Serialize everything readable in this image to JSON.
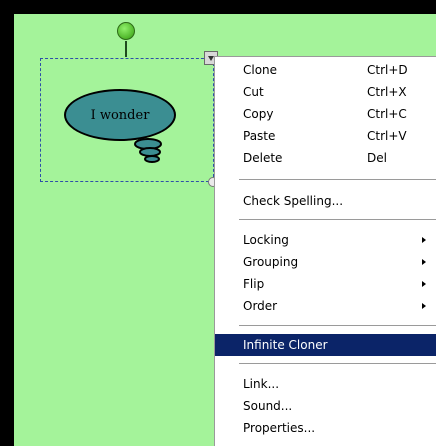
{
  "bubble": {
    "text": "I wonder",
    "fill": "#3b8e92"
  },
  "canvas_color": "#a4f39a",
  "menu": {
    "items": [
      {
        "label": "Clone",
        "shortcut": "Ctrl+D"
      },
      {
        "label": "Cut",
        "shortcut": "Ctrl+X"
      },
      {
        "label": "Copy",
        "shortcut": "Ctrl+C"
      },
      {
        "label": "Paste",
        "shortcut": "Ctrl+V"
      },
      {
        "label": "Delete",
        "shortcut": "Del"
      },
      {
        "label": "Check Spelling..."
      },
      {
        "label": "Locking"
      },
      {
        "label": "Grouping"
      },
      {
        "label": "Flip"
      },
      {
        "label": "Order"
      },
      {
        "label": "Infinite Cloner"
      },
      {
        "label": "Link..."
      },
      {
        "label": "Sound..."
      },
      {
        "label": "Properties..."
      }
    ],
    "highlight_color": "#0b2468"
  }
}
